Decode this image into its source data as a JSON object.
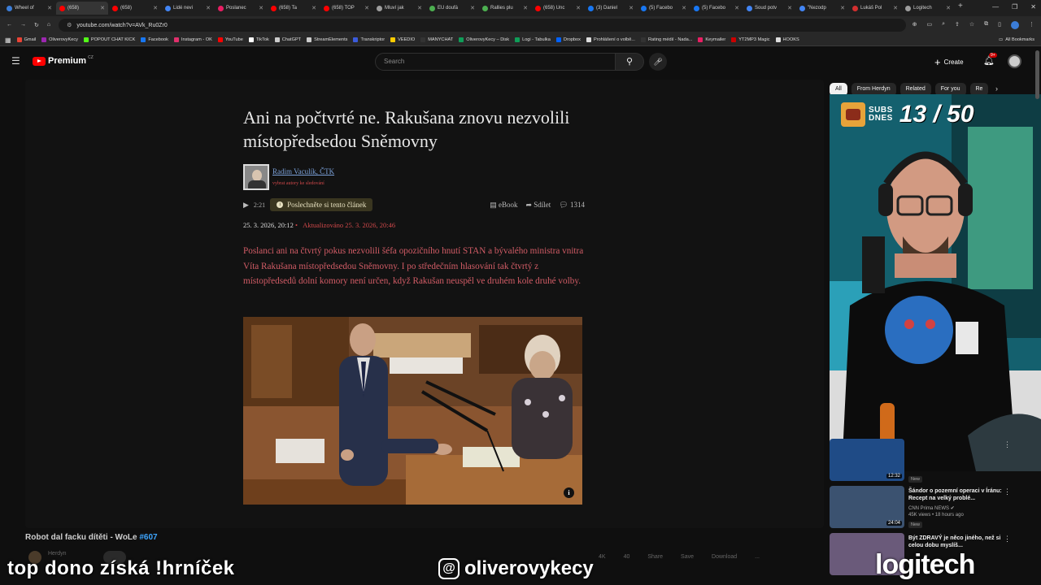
{
  "browser": {
    "tabs": [
      {
        "label": "Wheel of",
        "color": "#3b7dd8",
        "active": false
      },
      {
        "label": "(658)",
        "color": "#ff0000",
        "active": true
      },
      {
        "label": "(658)",
        "color": "#ff0000",
        "active": false
      },
      {
        "label": "Lidé nevi",
        "color": "#4285f4",
        "active": false
      },
      {
        "label": "Poslanec",
        "color": "#e91e63",
        "active": false
      },
      {
        "label": "(658) Ta",
        "color": "#ff0000",
        "active": false
      },
      {
        "label": "(658) TOP",
        "color": "#ff0000",
        "active": false
      },
      {
        "label": "Mluví jak",
        "color": "#9e9e9e",
        "active": false
      },
      {
        "label": "EU doufá",
        "color": "#4caf50",
        "active": false
      },
      {
        "label": "Rallies plu",
        "color": "#4caf50",
        "active": false
      },
      {
        "label": "(658) Unc",
        "color": "#ff0000",
        "active": false
      },
      {
        "label": "(3) Daniel",
        "color": "#1877f2",
        "active": false
      },
      {
        "label": "(5) Facebo",
        "color": "#1877f2",
        "active": false
      },
      {
        "label": "(5) Facebo",
        "color": "#1877f2",
        "active": false
      },
      {
        "label": "Soud potv",
        "color": "#4285f4",
        "active": false
      },
      {
        "label": "\"Nezodp",
        "color": "#4285f4",
        "active": false
      },
      {
        "label": "Lukáš Pol",
        "color": "#d32f2f",
        "active": false
      },
      {
        "label": "Logitech",
        "color": "#9e9e9e",
        "active": false
      }
    ],
    "url": "youtube.com/watch?v=AVk_Ru0Zr0",
    "bookmarks": [
      {
        "label": "Gmail",
        "color": "#ea4335"
      },
      {
        "label": "OliverovyKecy",
        "color": "#9c27b0"
      },
      {
        "label": "POPOUT CHAT KICK",
        "color": "#53fc18"
      },
      {
        "label": "Facebook",
        "color": "#1877f2"
      },
      {
        "label": "Instagram - OK",
        "color": "#e1306c"
      },
      {
        "label": "YouTube",
        "color": "#ff0000"
      },
      {
        "label": "TikTok",
        "color": "#ffffff"
      },
      {
        "label": "ChatGPT",
        "color": "#cccccc"
      },
      {
        "label": "StreamElements",
        "color": "#cccccc"
      },
      {
        "label": "Transkriptor",
        "color": "#3b5bdb"
      },
      {
        "label": "VEEDIO",
        "color": "#ffcc00"
      },
      {
        "label": "MANYCHAT",
        "color": "#333333"
      },
      {
        "label": "OliverovyKecy – Disk",
        "color": "#0f9d58"
      },
      {
        "label": "Logi - Tabulka",
        "color": "#0f9d58"
      },
      {
        "label": "Dropbox",
        "color": "#0061ff"
      },
      {
        "label": "Prohlášení o volbě...",
        "color": "#dddddd"
      },
      {
        "label": "Rating médií - Nada...",
        "color": "#333333"
      },
      {
        "label": "Keymailer",
        "color": "#e91e63"
      },
      {
        "label": "YT2MP3 Magic",
        "color": "#cc0000"
      },
      {
        "label": "HOOKS",
        "color": "#dddddd"
      }
    ],
    "all_bookmarks": "All Bookmarks"
  },
  "youtube": {
    "logo_text": "Premium",
    "country": "CZ",
    "search_placeholder": "Search",
    "create_label": "Create",
    "notif_count": "9+"
  },
  "article": {
    "title": "Ani na počtvrté ne. Rakušana znovu nezvolili místopředsedou Sněmovny",
    "author": "Radim Vaculík, ČTK",
    "author_sub": "vybrat autory ke sledování",
    "listen_time": "2:21",
    "listen_label": "Poslechněte si tento článek",
    "ebook": "eBook",
    "share": "Sdílet",
    "comments": "1314",
    "date": "25. 3. 2026, 20:12",
    "updated": "Aktualizováno 25. 3. 2026, 20:46",
    "lead": "Poslanci ani na čtvrtý pokus nezvolili šéfa opozičního hnutí STAN a bývalého ministra vnitra Víta Rakušana místopředsedou Sněmovny. I po středečním hlasování tak čtvrtý z místopředsedů dolní komory není určen, když Rakušan neuspěl ve druhém kole druhé volby."
  },
  "video": {
    "title": "Robot dal facku dítěti - WoLe",
    "tag": "#607",
    "channel": "Herdyn",
    "actions": [
      "4K",
      "40",
      "Share",
      "Save",
      "Download",
      "..."
    ]
  },
  "overlays": {
    "left_text": "top dono získá !hrníček",
    "center_text": "oliverovykecy",
    "right_text": "logitech",
    "subs_label_1": "SUBS",
    "subs_label_2": "DNES",
    "subs_count": "13 / 50"
  },
  "sidebar": {
    "chips": [
      "All",
      "From Herdyn",
      "Related",
      "For you",
      "Re"
    ],
    "recs": [
      {
        "duration": "12:32",
        "title": "",
        "channel": "",
        "stats": "",
        "badge": "New"
      },
      {
        "duration": "24:04",
        "title": "Šándor o pozemní operaci v Íránu: Recept na velký problé...",
        "channel": "CNN Prima NEWS ✔",
        "stats": "45K views • 18 hours ago",
        "badge": "New"
      },
      {
        "duration": "",
        "title": "Být ZDRAVÝ je něco jiného, než si celou dobu myslíš...",
        "channel": "",
        "stats": "",
        "badge": ""
      }
    ]
  }
}
